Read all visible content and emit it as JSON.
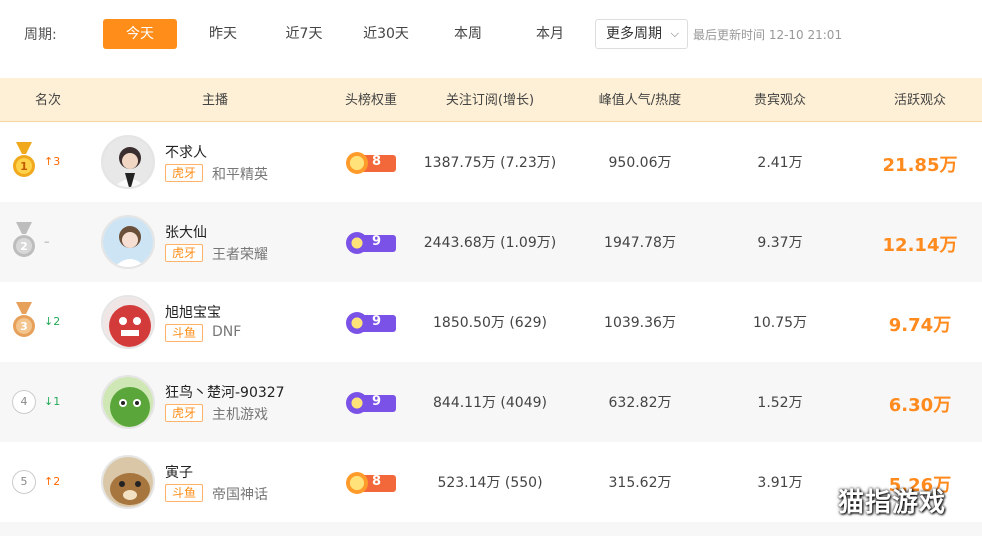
{
  "period": {
    "label": "周期:",
    "options": [
      "今天",
      "昨天",
      "近7天",
      "近30天",
      "本周",
      "本月"
    ],
    "active": "今天",
    "more": "更多周期",
    "updated": "最后更新时间 12-10 21:01"
  },
  "headers": [
    "名次",
    "主播",
    "头榜权重",
    "关注订阅(增长)",
    "峰值人气/热度",
    "贵宾观众",
    "活跃观众"
  ],
  "rows": [
    {
      "rank": "1",
      "trend": "↑3",
      "trend_dir": "up",
      "name": "不求人",
      "platform": "虎牙",
      "game": "和平精英",
      "weight": "8",
      "weight_type": "orange",
      "follow": "1387.75万 (7.23万)",
      "peak": "950.06万",
      "vip": "2.41万",
      "active": "21.85万"
    },
    {
      "rank": "2",
      "trend": "–",
      "trend_dir": "none",
      "name": "张大仙",
      "platform": "虎牙",
      "game": "王者荣耀",
      "weight": "9",
      "weight_type": "purple",
      "follow": "2443.68万 (1.09万)",
      "peak": "1947.78万",
      "vip": "9.37万",
      "active": "12.14万"
    },
    {
      "rank": "3",
      "trend": "↓2",
      "trend_dir": "down",
      "name": "旭旭宝宝",
      "platform": "斗鱼",
      "game": "DNF",
      "weight": "9",
      "weight_type": "purple",
      "follow": "1850.50万 (629)",
      "peak": "1039.36万",
      "vip": "10.75万",
      "active": "9.74万"
    },
    {
      "rank": "4",
      "trend": "↓1",
      "trend_dir": "down",
      "name": "狂鸟丶楚河-90327",
      "platform": "虎牙",
      "game": "主机游戏",
      "weight": "9",
      "weight_type": "purple",
      "follow": "844.11万 (4049)",
      "peak": "632.82万",
      "vip": "1.52万",
      "active": "6.30万"
    },
    {
      "rank": "5",
      "trend": "↑2",
      "trend_dir": "up",
      "name": "寅子",
      "platform": "斗鱼",
      "game": "帝国神话",
      "weight": "8",
      "weight_type": "orange",
      "follow": "523.14万 (550)",
      "peak": "315.62万",
      "vip": "3.91万",
      "active": "5.26万"
    }
  ],
  "watermark": "猫指游戏",
  "colors": {
    "accent": "#ff8d1a",
    "header_bg": "#fdf0d6",
    "gold": "#f0a81c",
    "silver": "#bdbdbd",
    "bronze": "#e6a05a"
  }
}
